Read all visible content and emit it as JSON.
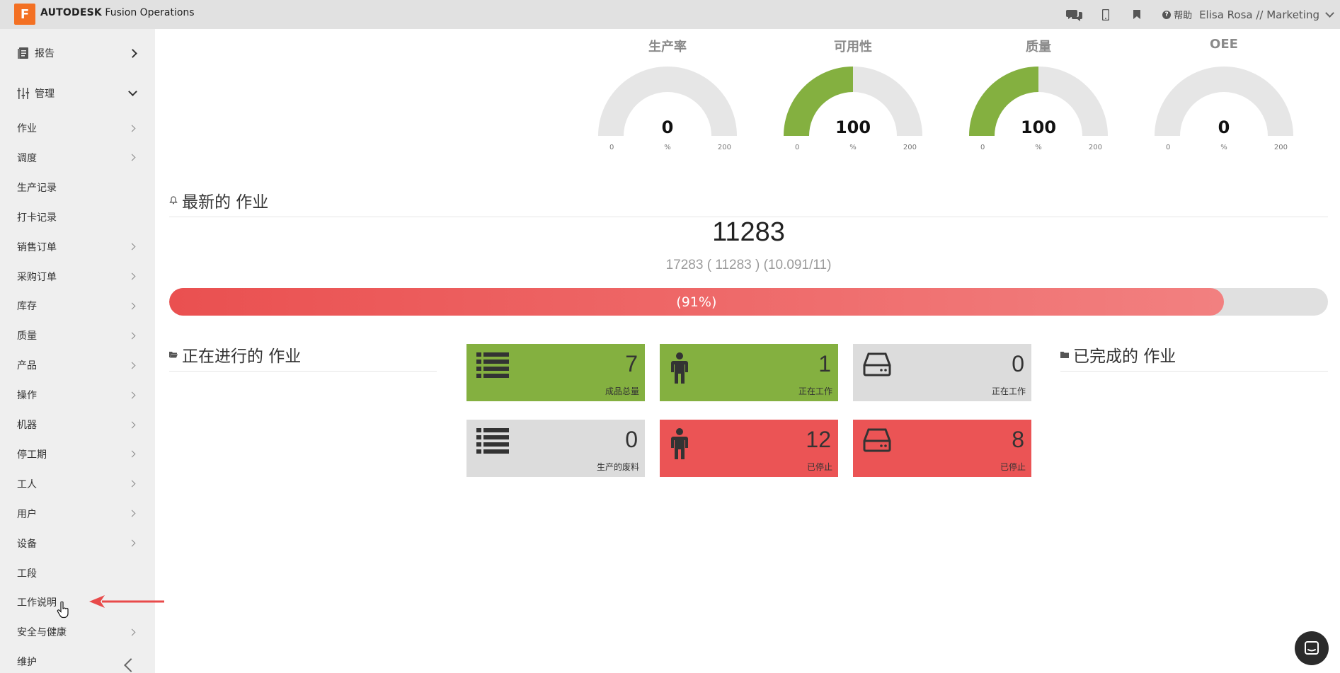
{
  "header": {
    "logo_letter": "F",
    "brand_bold": "AUTODESK",
    "brand_rest": " Fusion Operations",
    "help_label": "帮助",
    "user_label": "Elisa Rosa // Marketing",
    "icons": [
      "chat-icon",
      "mobile-icon",
      "bookmark-icon",
      "help-icon",
      "chevron-down-icon"
    ]
  },
  "sidebar": {
    "sections": [
      {
        "label": "报告",
        "icon": "report-icon",
        "state": "collapsed"
      },
      {
        "label": "管理",
        "icon": "sliders-icon",
        "state": "expanded"
      }
    ],
    "items": [
      {
        "label": "作业",
        "arrow": true
      },
      {
        "label": "调度",
        "arrow": true
      },
      {
        "label": "生产记录",
        "arrow": false
      },
      {
        "label": "打卡记录",
        "arrow": false
      },
      {
        "label": "销售订单",
        "arrow": true
      },
      {
        "label": "采购订单",
        "arrow": true
      },
      {
        "label": "库存",
        "arrow": true
      },
      {
        "label": "质量",
        "arrow": true
      },
      {
        "label": "产品",
        "arrow": true
      },
      {
        "label": "操作",
        "arrow": true
      },
      {
        "label": "机器",
        "arrow": true
      },
      {
        "label": "停工期",
        "arrow": true
      },
      {
        "label": "工人",
        "arrow": true
      },
      {
        "label": "用户",
        "arrow": true
      },
      {
        "label": "设备",
        "arrow": true
      },
      {
        "label": "工段",
        "arrow": false
      },
      {
        "label": "工作说明",
        "arrow": false
      },
      {
        "label": "安全与健康",
        "arrow": true
      },
      {
        "label": "维护",
        "arrow": false
      }
    ]
  },
  "gauges": [
    {
      "title": "生产率",
      "value": 0,
      "min": "0",
      "unit": "%",
      "max": "200",
      "fill_fraction": 0,
      "color": "#84b040"
    },
    {
      "title": "可用性",
      "value": 100,
      "min": "0",
      "unit": "%",
      "max": "200",
      "fill_fraction": 0.5,
      "color": "#84b040"
    },
    {
      "title": "质量",
      "value": 100,
      "min": "0",
      "unit": "%",
      "max": "200",
      "fill_fraction": 0.5,
      "color": "#84b040"
    },
    {
      "title": "OEE",
      "value": 0,
      "min": "0",
      "unit": "%",
      "max": "200",
      "fill_fraction": 0,
      "color": "#84b040"
    }
  ],
  "latest_job": {
    "heading": "最新的 作业",
    "number": "11283",
    "detail": "17283 ( 11283 ) (10.091/11)",
    "progress_label": "(91%)",
    "progress_percent": 91
  },
  "in_progress": {
    "heading": "正在进行的 作业"
  },
  "completed": {
    "heading": "已完成的 作业"
  },
  "tiles": [
    {
      "value": "7",
      "label": "成品总量",
      "icon": "list-icon",
      "color": "green"
    },
    {
      "value": "1",
      "label": "正在工作",
      "icon": "worker-icon",
      "color": "green"
    },
    {
      "value": "0",
      "label": "正在工作",
      "icon": "machine-icon",
      "color": "grey"
    },
    {
      "value": "0",
      "label": "生产的废料",
      "icon": "list-icon",
      "color": "grey"
    },
    {
      "value": "12",
      "label": "已停止",
      "icon": "worker-icon",
      "color": "red"
    },
    {
      "value": "8",
      "label": "已停止",
      "icon": "machine-icon",
      "color": "red"
    }
  ],
  "colors": {
    "accent_orange": "#f37023",
    "green": "#84b040",
    "red": "#eb5455",
    "grey": "#dcdcdc"
  }
}
